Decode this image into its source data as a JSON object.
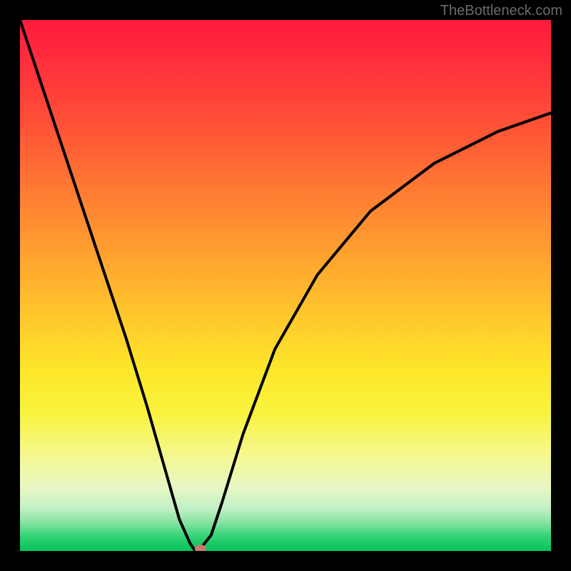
{
  "watermark": "TheBottleneck.com",
  "chart_data": {
    "type": "line",
    "title": "",
    "xlabel": "",
    "ylabel": "",
    "xlim": [
      0,
      100
    ],
    "ylim": [
      0,
      100
    ],
    "x": [
      0,
      4,
      8,
      12,
      16,
      20,
      24,
      28,
      30,
      32,
      33,
      34,
      36,
      38,
      42,
      48,
      56,
      66,
      78,
      90,
      100
    ],
    "values": [
      100,
      88,
      76,
      64,
      52,
      40,
      27,
      13,
      6,
      1.5,
      0,
      0.5,
      3,
      9,
      22,
      38,
      52,
      64,
      73,
      79,
      82.5
    ],
    "gradient_stops": [
      {
        "pos": 0,
        "color": "#ff1a3c"
      },
      {
        "pos": 0.08,
        "color": "#ff2f3c"
      },
      {
        "pos": 0.2,
        "color": "#ff5236"
      },
      {
        "pos": 0.32,
        "color": "#ff7a33"
      },
      {
        "pos": 0.44,
        "color": "#ffa12f"
      },
      {
        "pos": 0.56,
        "color": "#ffc82c"
      },
      {
        "pos": 0.66,
        "color": "#fde72a"
      },
      {
        "pos": 0.74,
        "color": "#f9f33d"
      },
      {
        "pos": 0.82,
        "color": "#f5f88f"
      },
      {
        "pos": 0.88,
        "color": "#e8f7c4"
      },
      {
        "pos": 0.92,
        "color": "#c2f0c6"
      },
      {
        "pos": 0.95,
        "color": "#7de19c"
      },
      {
        "pos": 0.97,
        "color": "#39d47a"
      },
      {
        "pos": 0.99,
        "color": "#15c862"
      },
      {
        "pos": 1.0,
        "color": "#07c25a"
      }
    ],
    "marker": {
      "x": 34,
      "y": 0,
      "color": "#c77a6e"
    }
  }
}
